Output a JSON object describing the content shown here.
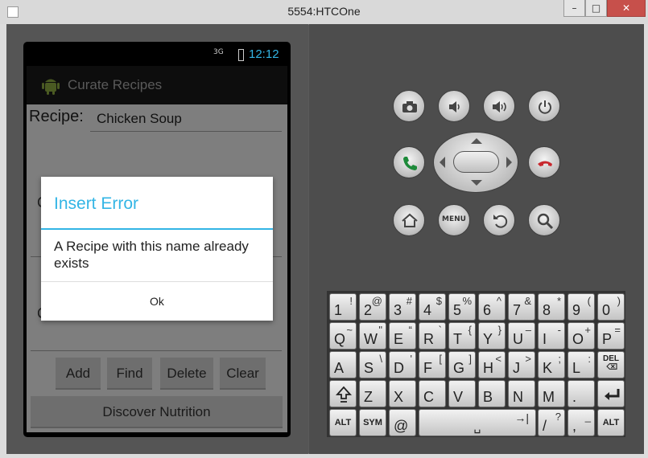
{
  "window": {
    "title": "5554:HTCOne",
    "min_label": "–",
    "max_label": "□",
    "close_label": "✕"
  },
  "status": {
    "signal": "3G",
    "time": "12:12"
  },
  "app": {
    "title": "Curate Recipes",
    "recipe_label": "Recipe:",
    "recipe_value": "Chicken Soup",
    "hidden_label_1": "C",
    "hidden_label_2": "C"
  },
  "buttons": {
    "add": "Add",
    "find": "Find",
    "delete": "Delete",
    "clear": "Clear",
    "discover": "Discover Nutrition"
  },
  "dialog": {
    "title": "Insert Error",
    "message": "A Recipe with this name already exists",
    "ok": "Ok"
  },
  "hardware": {
    "menu": "MENU"
  },
  "keyboard": {
    "row1": [
      [
        "1",
        "!"
      ],
      [
        "2",
        "@"
      ],
      [
        "3",
        "#"
      ],
      [
        "4",
        "$"
      ],
      [
        "5",
        "%"
      ],
      [
        "6",
        "^"
      ],
      [
        "7",
        "&"
      ],
      [
        "8",
        "*"
      ],
      [
        "9",
        "("
      ],
      [
        "0",
        ")"
      ]
    ],
    "row2": [
      [
        "Q",
        "~"
      ],
      [
        "W",
        "\""
      ],
      [
        "E",
        "“"
      ],
      [
        "R",
        "`"
      ],
      [
        "T",
        "{"
      ],
      [
        "Y",
        "}"
      ],
      [
        "U",
        "–"
      ],
      [
        "I",
        "-"
      ],
      [
        "O",
        "+"
      ],
      [
        "P",
        "="
      ]
    ],
    "row3": [
      [
        "A",
        ""
      ],
      [
        "S",
        "\\"
      ],
      [
        "D",
        "'"
      ],
      [
        "F",
        "["
      ],
      [
        "G",
        "]"
      ],
      [
        "H",
        "<"
      ],
      [
        "J",
        ">"
      ],
      [
        "K",
        ";"
      ],
      [
        "L",
        ":"
      ],
      [
        "DEL",
        ""
      ]
    ],
    "row4": [
      [
        "shift",
        ""
      ],
      [
        "Z",
        ""
      ],
      [
        "X",
        ""
      ],
      [
        "C",
        ""
      ],
      [
        "V",
        ""
      ],
      [
        "B",
        ""
      ],
      [
        "N",
        ""
      ],
      [
        "M",
        ""
      ],
      [
        ".",
        ""
      ],
      [
        "enter",
        ""
      ]
    ],
    "row5": {
      "alt_left": "ALT",
      "sym": "SYM",
      "at": "@",
      "space": "␣",
      "tab": "→|",
      "slash": "/",
      "question": "?",
      "comma": ",",
      "underscore": "_",
      "alt_right": "ALT"
    }
  }
}
